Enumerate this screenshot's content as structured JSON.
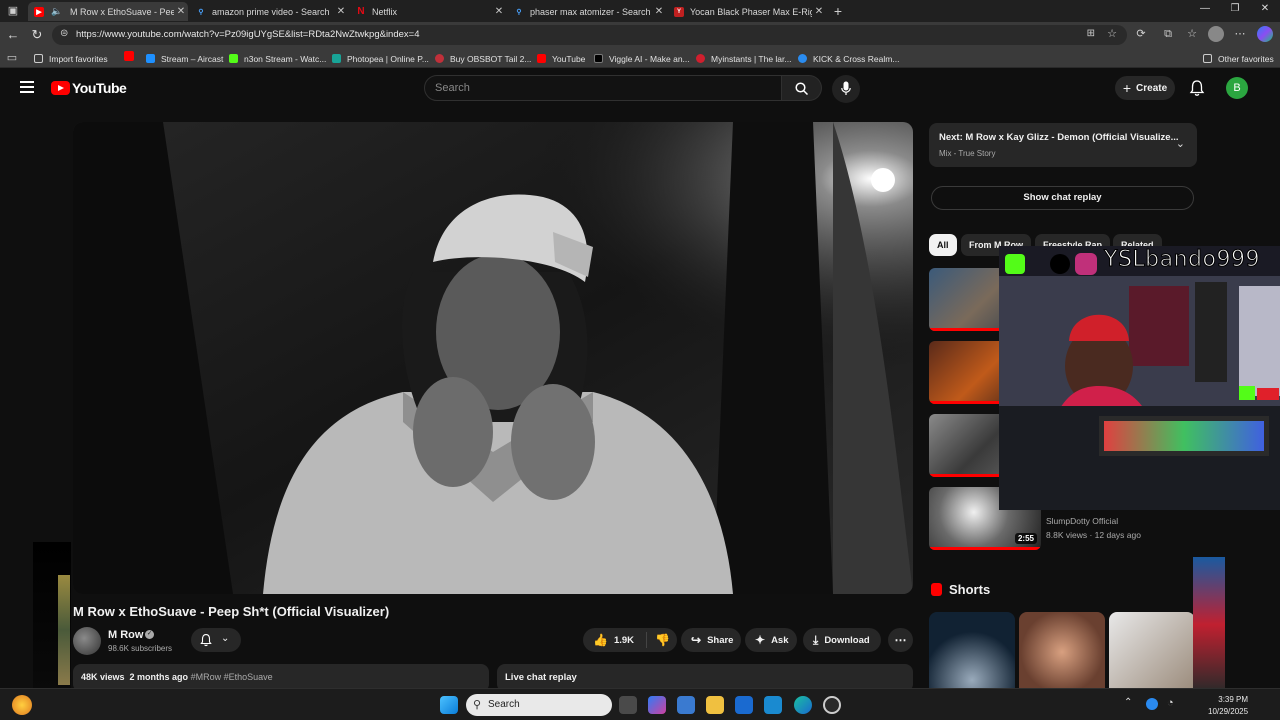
{
  "browser": {
    "tabs": [
      {
        "title": "M Row x EthoSuave - Peep Sh*t",
        "active": true
      },
      {
        "title": "amazon prime video - Search"
      },
      {
        "title": "Netflix"
      },
      {
        "title": "phaser max atomizer - Search"
      },
      {
        "title": "Yocan Black Phaser Max E-Rig for"
      }
    ],
    "url": "https://www.youtube.com/watch?v=Pz09igUYgSE&list=RDta2NwZtwkpg&index=4",
    "favorites": [
      "Import favorites",
      "Stream – Aircast",
      "n3on Stream - Watc...",
      "Photopea | Online P...",
      "Buy OBSBOT Tail 2...",
      "YouTube",
      "Viggle AI - Make an...",
      "Myinstants | The lar...",
      "KICK & Cross Realm..."
    ],
    "other_favorites": "Other favorites"
  },
  "youtube": {
    "logo": "YouTube",
    "search_placeholder": "Search",
    "create_label": "Create",
    "avatar_letter": "B"
  },
  "video": {
    "title": "M Row x EthoSuave - Peep Sh*t (Official Visualizer)",
    "channel": "M Row",
    "subscribers": "98.6K subscribers",
    "likes": "1.9K",
    "share_label": "Share",
    "ask_label": "Ask",
    "download_label": "Download",
    "views": "48K views",
    "age": "2 months ago",
    "hashtags": "#MRow #EthoSuave",
    "chat_replay_label": "Live chat replay"
  },
  "sidebar": {
    "next_title": "Next: M Row x Kay Glizz - Demon (Official Visualize...",
    "next_sub": "Mix - True Story",
    "show_chat": "Show chat replay",
    "chips": [
      "All",
      "From M Row",
      "Freestyle Rap",
      "Related"
    ],
    "item4_duration": "2:55",
    "item4_channel": "SlumpDotty Official",
    "item4_meta": "8.8K views · 12 days ago",
    "shorts_title": "Shorts"
  },
  "overlay": {
    "handle": "YSLbando999"
  },
  "taskbar": {
    "search": "Search",
    "time": "3:39 PM",
    "date": "10/29/2025"
  },
  "colors": {
    "yt_red": "#ff0000",
    "bg": "#0f0f0f",
    "chip_bg": "#272727"
  }
}
